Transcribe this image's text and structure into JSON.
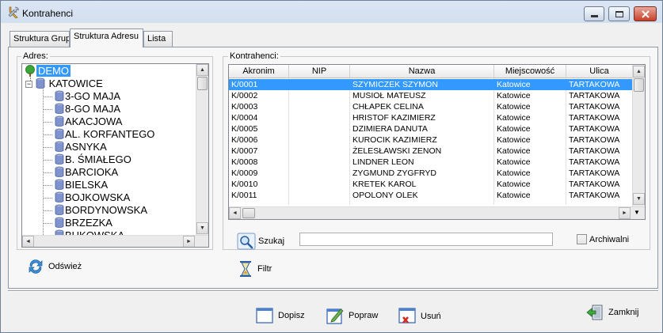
{
  "window": {
    "title": "Kontrahenci"
  },
  "tabs": [
    {
      "label": "Struktura Grup"
    },
    {
      "label": "Struktura Adresu"
    },
    {
      "label": "Lista"
    }
  ],
  "address_panel": {
    "label": "Adres:",
    "tree": [
      {
        "label": "DEMO",
        "icon": "tree-icon",
        "level": 0,
        "selected": true
      },
      {
        "label": "KATOWICE",
        "icon": "database-icon",
        "level": 1,
        "expanded": true
      },
      {
        "label": "3-GO MAJA",
        "icon": "database-icon",
        "level": 2
      },
      {
        "label": "8-GO MAJA",
        "icon": "database-icon",
        "level": 2
      },
      {
        "label": "AKACJOWA",
        "icon": "database-icon",
        "level": 2
      },
      {
        "label": "AL. KORFANTEGO",
        "icon": "database-icon",
        "level": 2
      },
      {
        "label": "ASNYKA",
        "icon": "database-icon",
        "level": 2
      },
      {
        "label": "B. ŚMIAŁEGO",
        "icon": "database-icon",
        "level": 2
      },
      {
        "label": "BARCIOKA",
        "icon": "database-icon",
        "level": 2
      },
      {
        "label": "BIELSKA",
        "icon": "database-icon",
        "level": 2
      },
      {
        "label": "BOJKOWSKA",
        "icon": "database-icon",
        "level": 2
      },
      {
        "label": "BORDYNOWSKA",
        "icon": "database-icon",
        "level": 2
      },
      {
        "label": "BRZEZKA",
        "icon": "database-icon",
        "level": 2
      },
      {
        "label": "BUKOWSKA",
        "icon": "database-icon",
        "level": 2
      }
    ],
    "refresh_label": "Odśwież"
  },
  "contractors_panel": {
    "label": "Kontrahenci:",
    "columns": [
      "Akronim",
      "NIP",
      "Nazwa",
      "Miejscowość",
      "Ulica"
    ],
    "rows": [
      [
        "K/0001",
        "",
        "SZYMICZEK SZYMON",
        "Katowice",
        "TARTAKOWA"
      ],
      [
        "K/0002",
        "",
        "MUSIOŁ MATEUSZ",
        "Katowice",
        "TARTAKOWA"
      ],
      [
        "K/0003",
        "",
        "CHŁAPEK CELINA",
        "Katowice",
        "TARTAKOWA"
      ],
      [
        "K/0004",
        "",
        "HRISTOF KAZIMIERZ",
        "Katowice",
        "TARTAKOWA"
      ],
      [
        "K/0005",
        "",
        "DZIMIERA DANUTA",
        "Katowice",
        "TARTAKOWA"
      ],
      [
        "K/0006",
        "",
        "KUROCIK KAZIMIERZ",
        "Katowice",
        "TARTAKOWA"
      ],
      [
        "K/0007",
        "",
        "ŻELESŁAWSKI ZENON",
        "Katowice",
        "TARTAKOWA"
      ],
      [
        "K/0008",
        "",
        "LINDNER LEON",
        "Katowice",
        "TARTAKOWA"
      ],
      [
        "K/0009",
        "",
        "ZYGMUND ZYGFRYD",
        "Katowice",
        "TARTAKOWA"
      ],
      [
        "K/0010",
        "",
        "KRETEK KAROL",
        "Katowice",
        "TARTAKOWA"
      ],
      [
        "K/0011",
        "",
        "OPOLONY  OLEK",
        "Katowice",
        "TARTAKOWA"
      ]
    ],
    "search_label": "Szukaj",
    "search_value": "",
    "archived_label": "Archiwalni",
    "archived_checked": false,
    "filter_label": "Filtr"
  },
  "footer": {
    "add_label": "Dopisz",
    "edit_label": "Popraw",
    "delete_label": "Usuń",
    "close_label": "Zamknij"
  },
  "colors": {
    "selection": "#3399ff",
    "window_frame": "#dbe6f3"
  }
}
